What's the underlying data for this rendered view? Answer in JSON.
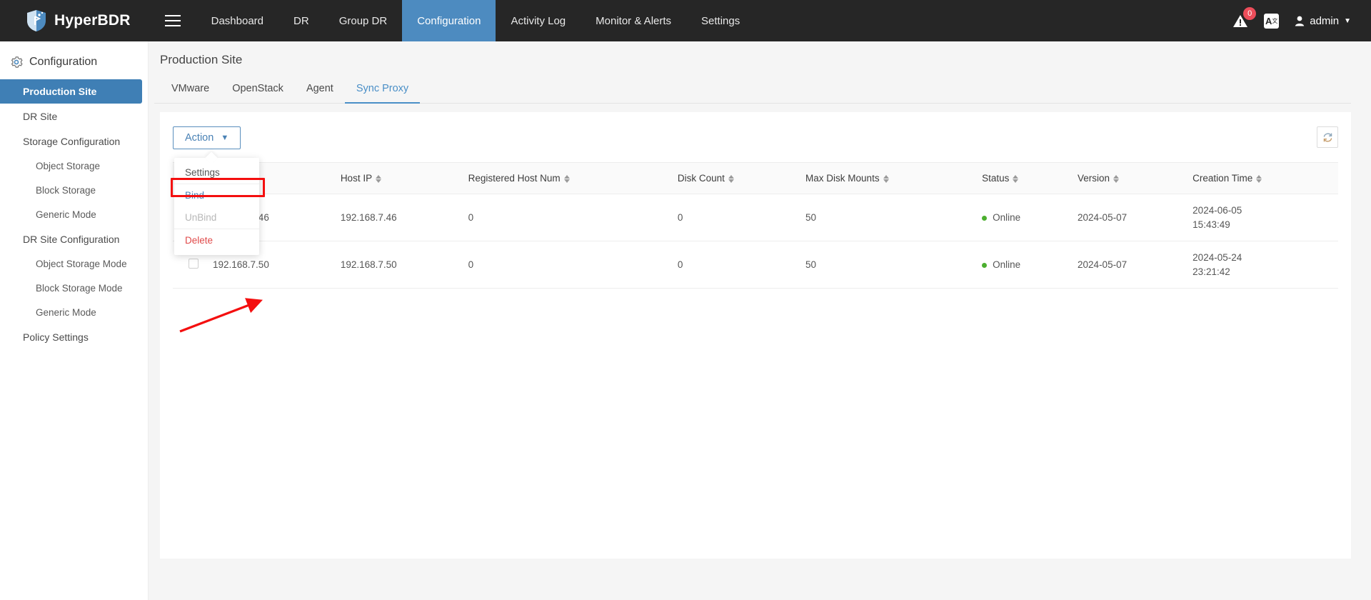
{
  "topnav": {
    "brand": "HyperBDR",
    "menu_icon": "hamburger-icon",
    "items": [
      {
        "label": "Dashboard",
        "active": false
      },
      {
        "label": "DR",
        "active": false
      },
      {
        "label": "Group DR",
        "active": false
      },
      {
        "label": "Configuration",
        "active": true
      },
      {
        "label": "Activity Log",
        "active": false
      },
      {
        "label": "Monitor & Alerts",
        "active": false
      },
      {
        "label": "Settings",
        "active": false
      }
    ],
    "alert_count": "0",
    "lang_label": "A",
    "lang_sup": "文",
    "user": "admin",
    "accent": "#4d8bc0",
    "background": "#262626"
  },
  "sidebar": {
    "title": "Configuration",
    "items": [
      {
        "label": "Production Site",
        "level": 1,
        "active": true
      },
      {
        "label": "DR Site",
        "level": 1,
        "active": false
      },
      {
        "label": "Storage Configuration",
        "level": 1,
        "active": false
      },
      {
        "label": "Object Storage",
        "level": 2,
        "active": false
      },
      {
        "label": "Block Storage",
        "level": 2,
        "active": false
      },
      {
        "label": "Generic Mode",
        "level": 2,
        "active": false
      },
      {
        "label": "DR Site Configuration",
        "level": 1,
        "active": false
      },
      {
        "label": "Object Storage Mode",
        "level": 2,
        "active": false
      },
      {
        "label": "Block Storage Mode",
        "level": 2,
        "active": false
      },
      {
        "label": "Generic Mode",
        "level": 2,
        "active": false
      },
      {
        "label": "Policy Settings",
        "level": 1,
        "active": false
      }
    ]
  },
  "main": {
    "page_title": "Production Site",
    "tabs": [
      {
        "label": "VMware",
        "active": false
      },
      {
        "label": "OpenStack",
        "active": false
      },
      {
        "label": "Agent",
        "active": false
      },
      {
        "label": "Sync Proxy",
        "active": true
      }
    ],
    "action_button": "Action",
    "refresh_icon": "refresh-icon",
    "dropdown": {
      "items": [
        {
          "label": "Settings",
          "state": "normal"
        },
        {
          "label": "Bind",
          "state": "highlight"
        },
        {
          "label": "UnBind",
          "state": "disabled"
        },
        {
          "label": "Delete",
          "state": "danger"
        }
      ],
      "highlight_color": "#f40f0f"
    },
    "table": {
      "columns": [
        {
          "label": "",
          "sortable": false
        },
        {
          "label": "Host IP",
          "sortable": true
        },
        {
          "label": "Registered Host Num",
          "sortable": true
        },
        {
          "label": "Disk Count",
          "sortable": true
        },
        {
          "label": "Max Disk Mounts",
          "sortable": true
        },
        {
          "label": "Status",
          "sortable": true
        },
        {
          "label": "Version",
          "sortable": true
        },
        {
          "label": "Creation Time",
          "sortable": true
        }
      ],
      "rows": [
        {
          "name": "192.168.7.46",
          "host_ip": "192.168.7.46",
          "registered_host_num": "0",
          "disk_count": "0",
          "max_disk_mounts": "50",
          "status": "Online",
          "version": "2024-05-07",
          "creation_date": "2024-06-05",
          "creation_time": "15:43:49"
        },
        {
          "name": "192.168.7.50",
          "host_ip": "192.168.7.50",
          "registered_host_num": "0",
          "disk_count": "0",
          "max_disk_mounts": "50",
          "status": "Online",
          "version": "2024-05-07",
          "creation_date": "2024-05-24",
          "creation_time": "23:21:42"
        }
      ],
      "status_color": "#4caf2f",
      "link_color": "#4a82b5"
    }
  }
}
